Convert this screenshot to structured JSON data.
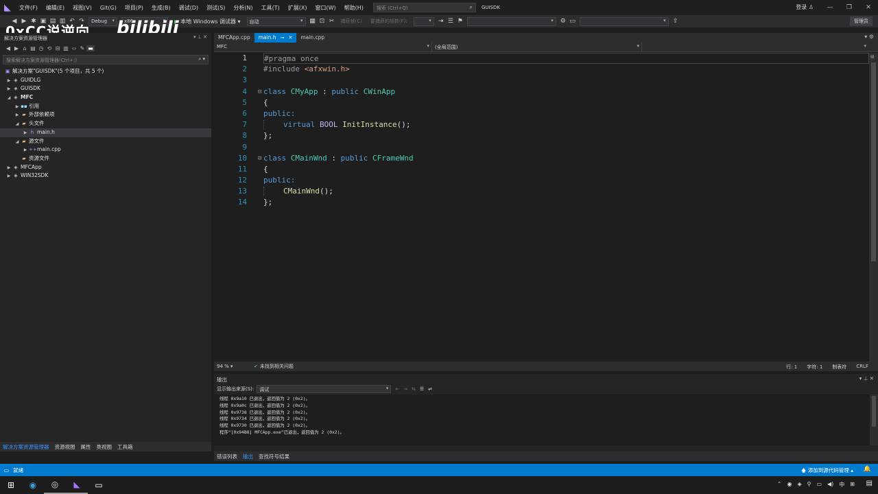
{
  "menubar": {
    "items": [
      "文件(F)",
      "编辑(E)",
      "视图(V)",
      "Git(G)",
      "项目(P)",
      "生成(B)",
      "调试(D)",
      "测试(S)",
      "分析(N)",
      "工具(T)",
      "扩展(X)",
      "窗口(W)",
      "帮助(H)"
    ],
    "search_placeholder": "搜索 (Ctrl+Q)",
    "solution_name": "GUISDK",
    "login": "登录"
  },
  "watermark": {
    "channel": "0xCC说逆向",
    "site_logo": "bilibili"
  },
  "toolbar": {
    "config": "Debug",
    "platform": "x86",
    "run_label": "本地 Windows 调试器",
    "run_mode": "自动",
    "capture_frame": "捕获帧(C)",
    "thread_label": "要捕获的帧数(F):",
    "manage": "管理员"
  },
  "solution_explorer": {
    "title": "解决方案资源管理器",
    "search_placeholder": "搜索解决方案资源管理器(Ctrl+;)",
    "solution_label": "解决方案\"GUISDK\"(5 个项目，共 5 个)",
    "items": [
      {
        "label": "GUIDLG",
        "indent": 0,
        "expanded": false,
        "icon": "project-icon"
      },
      {
        "label": "GUISDK",
        "indent": 0,
        "expanded": false,
        "icon": "project-icon"
      },
      {
        "label": "MFC",
        "indent": 0,
        "expanded": true,
        "icon": "project-icon"
      },
      {
        "label": "引用",
        "indent": 1,
        "expanded": false,
        "icon": "reference-icon"
      },
      {
        "label": "外部依赖项",
        "indent": 1,
        "expanded": false,
        "icon": "external-deps-icon"
      },
      {
        "label": "头文件",
        "indent": 1,
        "expanded": true,
        "icon": "folder-icon"
      },
      {
        "label": "main.h",
        "indent": 2,
        "expanded": false,
        "icon": "header-file-icon",
        "selected": true
      },
      {
        "label": "源文件",
        "indent": 1,
        "expanded": true,
        "icon": "folder-icon"
      },
      {
        "label": "main.cpp",
        "indent": 2,
        "expanded": false,
        "icon": "cpp-file-icon"
      },
      {
        "label": "资源文件",
        "indent": 1,
        "expanded": null,
        "icon": "folder-icon"
      },
      {
        "label": "MFCApp",
        "indent": 0,
        "expanded": false,
        "icon": "project-icon"
      },
      {
        "label": "WIN32SDK",
        "indent": 0,
        "expanded": false,
        "icon": "project-icon"
      }
    ],
    "bottom_tabs": [
      "解决方案资源管理器",
      "资源视图",
      "属性",
      "类视图",
      "工具箱"
    ]
  },
  "editor": {
    "tabs": [
      {
        "label": "MFCApp.cpp",
        "active": false
      },
      {
        "label": "main.h",
        "active": true
      },
      {
        "label": "main.cpp",
        "active": false
      }
    ],
    "nav_project": "MFC",
    "nav_scope": "(全局范围)",
    "nav_member": "",
    "line_numbers": [
      "1",
      "2",
      "3",
      "4",
      "5",
      "6",
      "7",
      "8",
      "9",
      "10",
      "11",
      "12",
      "13",
      "14"
    ],
    "zoom": "94 %",
    "issues": "未找到相关问题",
    "line_info": "行: 1",
    "char_info": "字符: 1",
    "tab_mode": "制表符",
    "line_ending": "CRLF"
  },
  "code": {
    "l1_directive": "#pragma once",
    "l2_directive": "#include ",
    "l2_header": "<afxwin.h>",
    "l4_class": "class",
    "l4_name": "CMyApp",
    "l4_colon": " : ",
    "l4_public": "public",
    "l4_base": "CWinApp",
    "brace_open": "{",
    "public_label": "public:",
    "l7_virtual": "virtual",
    "l7_type": "BOOL",
    "l7_func": "InitInstance",
    "l7_rest": "();",
    "brace_close": "};",
    "l10_class": "class",
    "l10_name": "CMainWnd",
    "l10_colon": " : ",
    "l10_public": "public",
    "l10_base": "CFrameWnd",
    "l13_func": "CMainWnd",
    "l13_rest": "();"
  },
  "output": {
    "title": "输出",
    "source_label": "显示输出来源(S):",
    "source_value": "调试",
    "lines": [
      "线程 0x9a10 已退出，返回值为 2 (0x2)。",
      "线程 0x9a0c 已退出，返回值为 2 (0x2)。",
      "线程 0x9738 已退出，返回值为 2 (0x2)。",
      "线程 0x9734 已退出，返回值为 2 (0x2)。",
      "线程 0x9730 已退出，返回值为 2 (0x2)。",
      "程序“[0x94B8] MFCApp.exe”已退出，返回值为 2 (0x2)。"
    ],
    "bottom_tabs": [
      "错误列表",
      "输出",
      "查找符号结果"
    ]
  },
  "statusbar": {
    "ready": "就绪",
    "source_control": "添加到源代码管理"
  },
  "taskbar": {
    "ime": "中"
  },
  "colors": {
    "accent": "#007acc",
    "keyword": "#569cd6",
    "type": "#4ec9b0",
    "string": "#d69d85",
    "function": "#dcdcaa",
    "line_number": "#2b91af"
  }
}
